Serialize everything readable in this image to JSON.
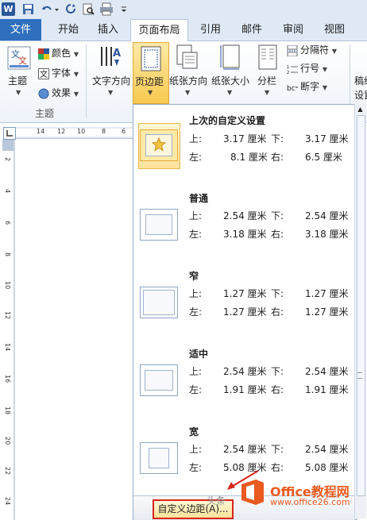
{
  "qat": {
    "word_logo": "W",
    "icons": [
      "save-icon",
      "undo-icon",
      "redo-icon",
      "print-preview-icon",
      "print-icon",
      "customize-qat-icon"
    ]
  },
  "tabs": [
    {
      "label": "文件",
      "active": false
    },
    {
      "label": "开始",
      "active": false
    },
    {
      "label": "插入",
      "active": false
    },
    {
      "label": "页面布局",
      "active": true
    },
    {
      "label": "引用",
      "active": false
    },
    {
      "label": "邮件",
      "active": false
    },
    {
      "label": "审阅",
      "active": false
    },
    {
      "label": "视图",
      "active": false
    }
  ],
  "ribbon": {
    "themes": {
      "label": "主题",
      "colors": "颜色",
      "fonts": "字体",
      "effects": "效果",
      "group_label": "主题"
    },
    "text_direction": "文字方向",
    "margins": "页边距",
    "orientation": "纸张方向",
    "size": "纸张大小",
    "columns": "分栏",
    "breaks": "分隔符",
    "line_numbers": "行号",
    "hyphenation": "断字",
    "cut_off_1": "稿纸",
    "cut_off_2": "设置"
  },
  "ruler": {
    "h_ticks": [
      "14",
      "12",
      "10",
      "8",
      "6"
    ],
    "v_ticks": [
      "2",
      "4",
      "6",
      "8",
      "10",
      "12",
      "14",
      "16",
      "18",
      "20",
      "22",
      "24"
    ]
  },
  "margins_menu": {
    "unit": "厘米",
    "labels": {
      "top": "上:",
      "bottom": "下:",
      "left": "左:",
      "right": "右:"
    },
    "presets": [
      {
        "name": "上次的自定义设置",
        "top": "3.17 厘米",
        "bottom": "3.17 厘米",
        "left": "8.1 厘米",
        "right": "6.5 厘米",
        "selected": true
      },
      {
        "name": "普通",
        "top": "2.54 厘米",
        "bottom": "2.54 厘米",
        "left": "3.18 厘米",
        "right": "3.18 厘米",
        "selected": false
      },
      {
        "name": "窄",
        "top": "1.27 厘米",
        "bottom": "1.27 厘米",
        "left": "1.27 厘米",
        "right": "1.27 厘米",
        "selected": false
      },
      {
        "name": "适中",
        "top": "2.54 厘米",
        "bottom": "2.54 厘米",
        "left": "1.91 厘米",
        "right": "1.91 厘米",
        "selected": false
      },
      {
        "name": "宽",
        "top": "2.54 厘米",
        "bottom": "2.54 厘米",
        "left": "5.08 厘米",
        "right": "5.08 厘米",
        "selected": false
      }
    ],
    "custom_button": "自定义边距(A)..."
  },
  "watermark": {
    "brand": "Office教程网",
    "url": "www.office26.com",
    "small": "头条"
  },
  "colors": {
    "accent": "#2f6fbd",
    "highlight": "#fde39a",
    "annotation": "#d9231b",
    "watermark": "#ea5a20"
  }
}
